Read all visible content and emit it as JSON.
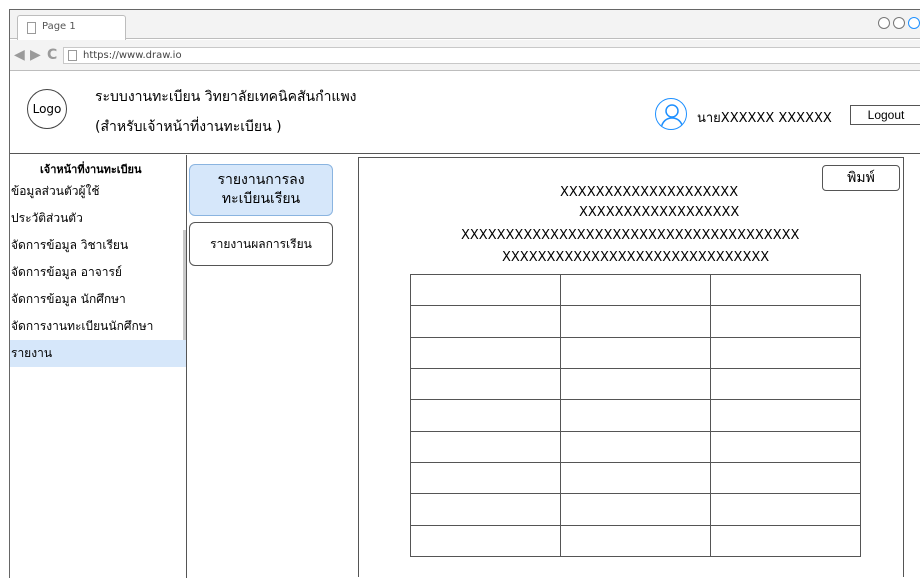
{
  "browser": {
    "tab_label": "Page 1",
    "url": "https://www.draw.io"
  },
  "header": {
    "logo_text": "Logo",
    "title": "ระบบงานทะเบียน วิทยาลัยเทคนิคสันกำแพง",
    "subtitle": "(สำหรับเจ้าหน้าที่งานทะเบียน )",
    "user_name": "นายXXXXXX XXXXXX",
    "logout_label": "Logout"
  },
  "sidebar": {
    "heading": "เจ้าหน้าที่งานทะเบียน",
    "items": [
      {
        "label": "ข้อมูลส่วนตัวผู้ใช้"
      },
      {
        "label": "ประวัติส่วนตัว"
      },
      {
        "label": "จัดการข้อมูล วิชาเรียน"
      },
      {
        "label": "จัดการข้อมูล อาจารย์"
      },
      {
        "label": "จัดการข้อมูล นักศึกษา"
      },
      {
        "label": "จัดการงานทะเบียนนักศึกษา"
      },
      {
        "label": "รายงาน"
      }
    ],
    "active_item": "รายงาน"
  },
  "report_tabs": {
    "registration_line1": "รายงานการลง",
    "registration_line2": "ทะเบียนเรียน",
    "results": "รายงานผลการเรียน"
  },
  "report": {
    "print_label": "พิมพ์",
    "heading_lines": [
      "XXXXXXXXXXXXXXXXXXXX",
      "XXXXXXXXXXXXXXXXXX",
      "XXXXXXXXXXXXXXXXXXXXXXXXXXXXXXXXXXXXXX",
      "XXXXXXXXXXXXXXXXXXXXXXXXXXXXXX"
    ],
    "table": {
      "columns": 3,
      "rows": 9,
      "cells": [
        [
          "",
          "",
          ""
        ],
        [
          "",
          "",
          ""
        ],
        [
          "",
          "",
          ""
        ],
        [
          "",
          "",
          ""
        ],
        [
          "",
          "",
          ""
        ],
        [
          "",
          "",
          ""
        ],
        [
          "",
          "",
          ""
        ],
        [
          "",
          "",
          ""
        ],
        [
          "",
          "",
          ""
        ]
      ]
    }
  },
  "colors": {
    "active_bg": "#d6e7fa",
    "user_icon": "#1e90ff",
    "border": "#555555"
  },
  "icons": {
    "tab": "page-icon",
    "nav": [
      "back-arrow-icon",
      "forward-arrow-icon",
      "reload-icon"
    ],
    "user": "user-avatar-icon"
  }
}
